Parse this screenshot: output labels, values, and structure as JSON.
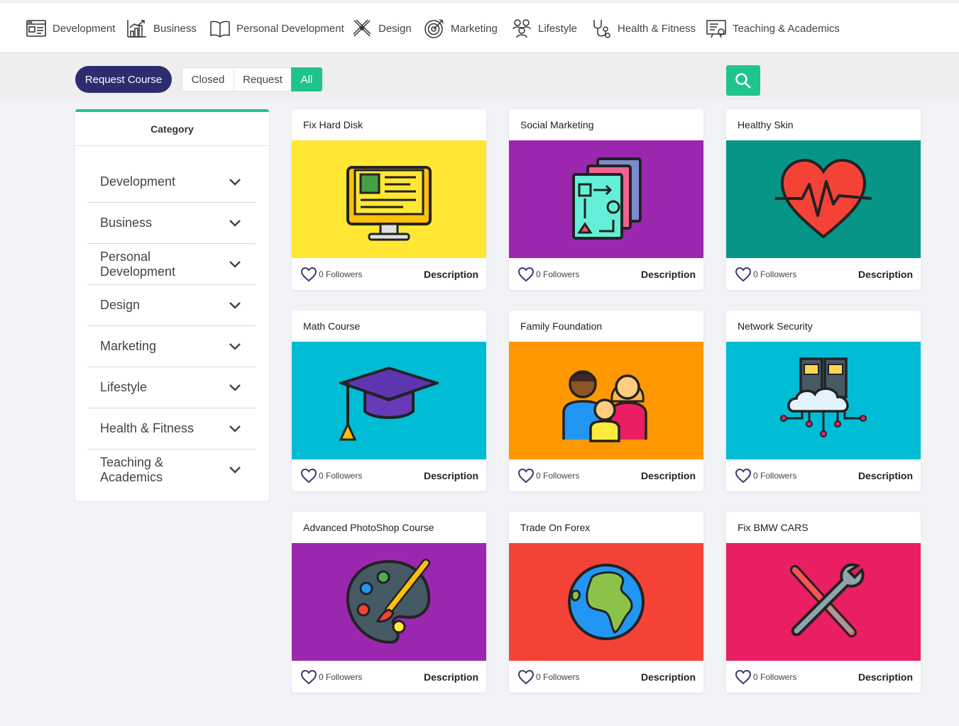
{
  "nav": [
    {
      "label": "Development",
      "icon": "development-icon"
    },
    {
      "label": "Business",
      "icon": "business-icon"
    },
    {
      "label": "Personal Development",
      "icon": "book-icon"
    },
    {
      "label": "Design",
      "icon": "design-icon"
    },
    {
      "label": "Marketing",
      "icon": "target-icon"
    },
    {
      "label": "Lifestyle",
      "icon": "people-icon"
    },
    {
      "label": "Health & Fitness",
      "icon": "stethoscope-icon"
    },
    {
      "label": "Teaching & Academics",
      "icon": "teaching-icon"
    }
  ],
  "filter": {
    "request_course": "Request Course",
    "segments": [
      "Closed",
      "Request",
      "All"
    ],
    "active_segment": "All"
  },
  "sidebar": {
    "title": "Category",
    "items": [
      "Development",
      "Business",
      "Personal Development",
      "Design",
      "Marketing",
      "Lifestyle",
      "Health & Fitness",
      "Teaching & Academics"
    ]
  },
  "cards": [
    {
      "title": "Fix Hard Disk",
      "followers": "0 Followers",
      "action": "Description",
      "color": "#ffe733",
      "icon": "computer-icon"
    },
    {
      "title": "Social Marketing",
      "followers": "0 Followers",
      "action": "Description",
      "color": "#9b27af",
      "icon": "layers-icon"
    },
    {
      "title": "Healthy Skin",
      "followers": "0 Followers",
      "action": "Description",
      "color": "#069587",
      "icon": "heart-pulse-icon"
    },
    {
      "title": "Math Course",
      "followers": "0 Followers",
      "action": "Description",
      "color": "#00bcd5",
      "icon": "graduation-cap-icon"
    },
    {
      "title": "Family Foundation",
      "followers": "0 Followers",
      "action": "Description",
      "color": "#ff9800",
      "icon": "family-icon"
    },
    {
      "title": "Network Security",
      "followers": "0 Followers",
      "action": "Description",
      "color": "#00bcd5",
      "icon": "cloud-server-icon"
    },
    {
      "title": "Advanced PhotoShop Course",
      "followers": "0 Followers",
      "action": "Description",
      "color": "#9b27af",
      "icon": "palette-icon"
    },
    {
      "title": "Trade On Forex",
      "followers": "0 Followers",
      "action": "Description",
      "color": "#f44336",
      "icon": "globe-icon"
    },
    {
      "title": "Fix BMW CARS",
      "followers": "0 Followers",
      "action": "Description",
      "color": "#e91e63",
      "icon": "tools-icon"
    }
  ]
}
